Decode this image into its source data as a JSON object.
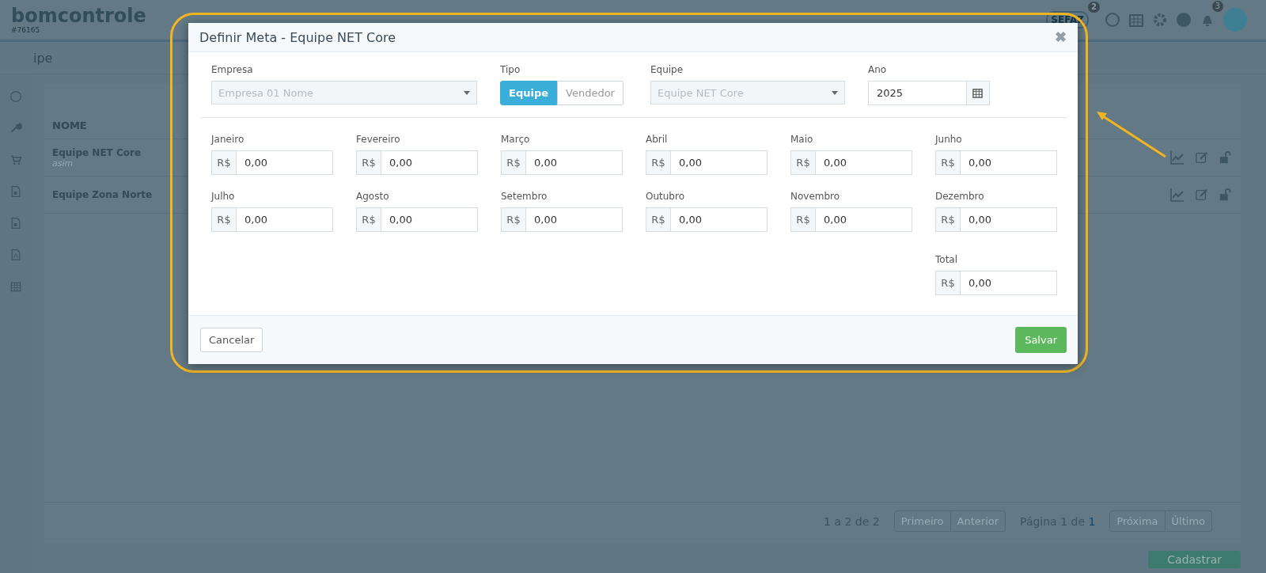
{
  "app": {
    "logo": "bomcontrole",
    "account": "#76165",
    "header": {
      "sefaz": "SEFAZ",
      "sefaz_badge": "2",
      "bell_badge": "3"
    },
    "page_title": "ipe",
    "table": {
      "columns": [
        "NOME"
      ],
      "rows": [
        {
          "name": "Equipe NET Core",
          "note": "asim"
        },
        {
          "name": "Equipe Zona Norte"
        }
      ]
    },
    "pagination": {
      "summary": "1 a 2 de 2",
      "page_label": "Página 1 de ",
      "page_number": "1",
      "first_buttons": [
        {
          "label": "Primeiro",
          "disabled": true
        },
        {
          "label": "Anterior",
          "disabled": true
        }
      ],
      "last_buttons": [
        {
          "label": "Próxima",
          "disabled": true
        },
        {
          "label": "Último",
          "disabled": true
        }
      ]
    },
    "add_button": "Cadastrar"
  },
  "modal": {
    "title": "Definir Meta - Equipe NET Core",
    "close": "✖",
    "empresa": {
      "label": "Empresa",
      "value": "Empresa 01 Nome",
      "disabled": true
    },
    "tipo": {
      "label": "Tipo",
      "options": [
        {
          "label": "Equipe",
          "selected": true
        },
        {
          "label": "Vendedor",
          "selected": false
        }
      ]
    },
    "equipe": {
      "label": "Equipe",
      "value": "Equipe NET Core",
      "disabled": true
    },
    "ano": {
      "label": "Ano",
      "value": "2025"
    },
    "months": [
      {
        "label": "Janeiro",
        "prefix": "R$",
        "value": "0,00"
      },
      {
        "label": "Fevereiro",
        "prefix": "R$",
        "value": "0,00"
      },
      {
        "label": "Março",
        "prefix": "R$",
        "value": "0,00"
      },
      {
        "label": "Abril",
        "prefix": "R$",
        "value": "0,00"
      },
      {
        "label": "Maio",
        "prefix": "R$",
        "value": "0,00"
      },
      {
        "label": "Junho",
        "prefix": "R$",
        "value": "0,00"
      },
      {
        "label": "Julho",
        "prefix": "R$",
        "value": "0,00"
      },
      {
        "label": "Agosto",
        "prefix": "R$",
        "value": "0,00"
      },
      {
        "label": "Setembro",
        "prefix": "R$",
        "value": "0,00"
      },
      {
        "label": "Outubro",
        "prefix": "R$",
        "value": "0,00"
      },
      {
        "label": "Novembro",
        "prefix": "R$",
        "value": "0,00"
      },
      {
        "label": "Dezembro",
        "prefix": "R$",
        "value": "0,00"
      }
    ],
    "total": {
      "label": "Total",
      "prefix": "R$",
      "value": "0,00"
    },
    "cancel": "Cancelar",
    "save": "Salvar"
  }
}
